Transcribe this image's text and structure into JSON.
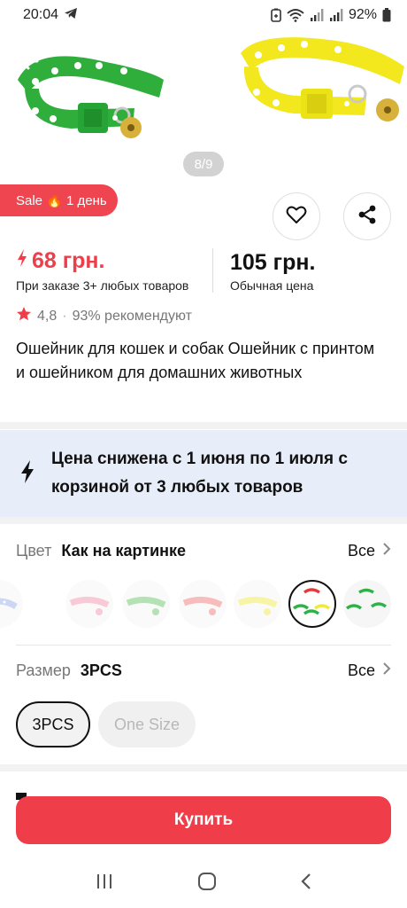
{
  "status_bar": {
    "time": "20:04",
    "battery": "92%",
    "icons": [
      "telegram-icon",
      "battery-saver-icon",
      "wifi-icon",
      "signal-icon",
      "signal-icon",
      "battery-icon"
    ]
  },
  "gallery": {
    "page_indicator": "8/9",
    "images": [
      "green-collar",
      "yellow-collar"
    ]
  },
  "sale_badge": {
    "text": "Sale 🔥 1 день"
  },
  "actions": {
    "favorite_icon": "heart-icon",
    "share_icon": "share-icon"
  },
  "price": {
    "promo": "68 грн.",
    "promo_note": "При заказе 3+ любых товаров",
    "regular": "105 грн.",
    "regular_note": "Обычная цена"
  },
  "rating": {
    "value": "4,8",
    "separator": "·",
    "recommend": "93% рекомендуют"
  },
  "product": {
    "title": "Ошейник для кошек и собак Ошейник с принтом и ошейником для домашних животных"
  },
  "promo_banner": {
    "text": "Цена снижена с 1 июня по 1 июля с корзиной от 3 любых товаров",
    "icon": "lightning-icon"
  },
  "color": {
    "label": "Цвет",
    "value": "Как на картинке",
    "all": "Все",
    "swatches": [
      {
        "color": "#8fa8e6",
        "selected": false
      },
      {
        "color": "#f08aa8",
        "selected": false
      },
      {
        "color": "#5bbf5b",
        "selected": false
      },
      {
        "color": "#ef6f6f",
        "selected": false
      },
      {
        "color": "#eeea3a",
        "selected": false
      },
      {
        "color": "multi",
        "selected": true
      },
      {
        "color": "#2fb14a",
        "selected": false
      }
    ]
  },
  "size": {
    "label": "Размер",
    "value": "3PCS",
    "all": "Все",
    "options": [
      "3PCS",
      "One Size"
    ]
  },
  "buy_button": {
    "label": "Купить"
  },
  "colors": {
    "accent": "#ef3e4a",
    "banner_bg": "#e8eef9"
  }
}
